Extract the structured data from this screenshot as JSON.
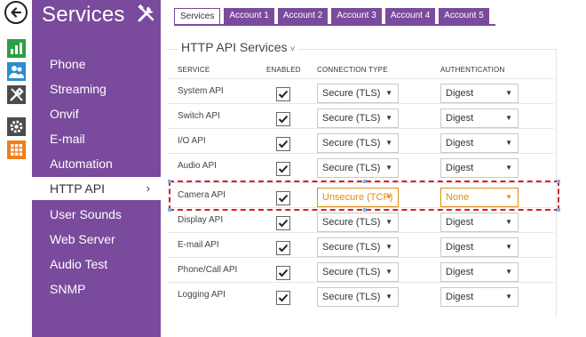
{
  "sidebar": {
    "title": "Services",
    "items": [
      {
        "label": "Phone"
      },
      {
        "label": "Streaming"
      },
      {
        "label": "Onvif"
      },
      {
        "label": "E-mail"
      },
      {
        "label": "Automation"
      },
      {
        "label": "HTTP API",
        "active": true,
        "chevron": "›"
      },
      {
        "label": "User Sounds"
      },
      {
        "label": "Web Server"
      },
      {
        "label": "Audio Test"
      },
      {
        "label": "SNMP"
      }
    ]
  },
  "rail": {
    "icons": [
      "back-arrow-icon",
      "bar-chart-icon",
      "users-icon",
      "tools-icon",
      "gear-icon",
      "grid-icon"
    ],
    "colors": {
      "bar_chart": "#2e9e45",
      "users": "#2b8ccf",
      "tools": "#4b4b4b",
      "gear": "#4b4b4b",
      "grid": "#f07d1a"
    }
  },
  "tabs": [
    {
      "label": "Services",
      "active": true
    },
    {
      "label": "Account 1"
    },
    {
      "label": "Account 2"
    },
    {
      "label": "Account 3"
    },
    {
      "label": "Account 4"
    },
    {
      "label": "Account 5"
    }
  ],
  "section": {
    "title": "HTTP API Services",
    "caret": "˅"
  },
  "columns": {
    "service": "SERVICE",
    "enabled": "ENABLED",
    "connection_type": "CONNECTION TYPE",
    "authentication": "AUTHENTICATION"
  },
  "rows": [
    {
      "name": "System API",
      "enabled": true,
      "connection": "Secure (TLS)",
      "auth": "Digest"
    },
    {
      "name": "Switch API",
      "enabled": true,
      "connection": "Secure (TLS)",
      "auth": "Digest"
    },
    {
      "name": "I/O API",
      "enabled": true,
      "connection": "Secure (TLS)",
      "auth": "Digest"
    },
    {
      "name": "Audio API",
      "enabled": true,
      "connection": "Secure (TLS)",
      "auth": "Digest"
    },
    {
      "name": "Camera API",
      "enabled": true,
      "connection": "Unsecure (TCP)",
      "auth": "None",
      "warning": true
    },
    {
      "name": "Display API",
      "enabled": true,
      "connection": "Secure (TLS)",
      "auth": "Digest"
    },
    {
      "name": "E-mail API",
      "enabled": true,
      "connection": "Secure (TLS)",
      "auth": "Digest"
    },
    {
      "name": "Phone/Call API",
      "enabled": true,
      "connection": "Secure (TLS)",
      "auth": "Digest"
    },
    {
      "name": "Logging API",
      "enabled": true,
      "connection": "Secure (TLS)",
      "auth": "Digest"
    }
  ],
  "dropdown_arrow": "▼",
  "colors": {
    "brand_purple": "#7a4a9c",
    "warning_orange": "#e08a14",
    "highlight_red": "#d81b2e"
  }
}
